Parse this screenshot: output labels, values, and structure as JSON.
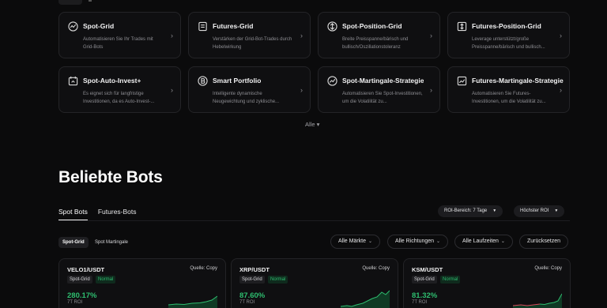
{
  "strategies": [
    {
      "title": "Spot-Grid",
      "desc": "Automatisieren Sie Ihr Trades mit Grid-Bots",
      "icon": "spot-grid-icon"
    },
    {
      "title": "Futures-Grid",
      "desc": "Verstärken der Grid-Bot-Trades durch Hebelwirkung",
      "icon": "futures-grid-icon"
    },
    {
      "title": "Spot-Position-Grid",
      "desc": "Breite Preisspanne/bärisch und bullisch/Oszillationstoleranz",
      "icon": "spot-position-grid-icon"
    },
    {
      "title": "Futures-Position-Grid",
      "desc": "Leverage unterstützt/große Preisspanne/bärisch und bullisch...",
      "icon": "futures-position-grid-icon"
    },
    {
      "title": "Spot-Auto-Invest+",
      "desc": "Es eignet sich für langfristige Investitionen, da es Auto-Invest-...",
      "icon": "auto-invest-icon"
    },
    {
      "title": "Smart Portfolio",
      "desc": "Intelligente dynamische Neugewichtung und zyklische...",
      "icon": "smart-portfolio-icon"
    },
    {
      "title": "Spot-Martingale-Strategie",
      "desc": "Automatisieren Sie Spot-Investitionen, um die Volatilität zu...",
      "icon": "spot-martingale-icon"
    },
    {
      "title": "Futures-Martingale-Strategie",
      "desc": "Automatisieren Sie Futures-Investitionen, um die Volatilität zu...",
      "icon": "futures-martingale-icon"
    }
  ],
  "all_label": "Alle",
  "section_title": "Beliebte Bots",
  "tabs": {
    "spot": "Spot Bots",
    "futures": "Futures-Bots"
  },
  "dropdowns": {
    "roi_range": "ROI-Bereich: 7 Tage",
    "sort": "Höchster ROI"
  },
  "chips": {
    "spot_grid": "Spot-Grid",
    "spot_martingale": "Spot Martingale"
  },
  "filters": {
    "markets": "Alle Märkte",
    "directions": "Alle Richtungen",
    "durations": "Alle Laufzeiten",
    "reset": "Zurücksetzen"
  },
  "bots": [
    {
      "pair": "VELO1/USDT",
      "source": "Quelle: Copy",
      "type": "Spot-Grid",
      "status": "Normal",
      "roi": "280.17%",
      "roi_label": "7T ROI"
    },
    {
      "pair": "XRP/USDT",
      "source": "Quelle: Copy",
      "type": "Spot-Grid",
      "status": "Normal",
      "roi": "87.60%",
      "roi_label": "7T ROI"
    },
    {
      "pair": "KSM/USDT",
      "source": "Quelle: Copy",
      "type": "Spot-Grid",
      "status": "Normal",
      "roi": "81.32%",
      "roi_label": "7T ROI"
    }
  ],
  "colors": {
    "accent_green": "#2ebd6f",
    "background": "#0b0b0c"
  }
}
